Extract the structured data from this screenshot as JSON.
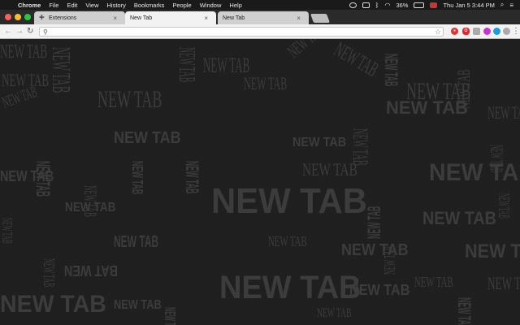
{
  "menubar": {
    "apple_glyph": "",
    "app_name": "Chrome",
    "menus": [
      "File",
      "Edit",
      "View",
      "History",
      "Bookmarks",
      "People",
      "Window",
      "Help"
    ],
    "battery": "36%",
    "clock": "Thu Jan 5  3:44 PM"
  },
  "tabs": [
    {
      "title": "Extensions",
      "icon": "puzzle-icon",
      "active": false
    },
    {
      "title": "New Tab",
      "active": true
    },
    {
      "title": "New Tab",
      "active": false
    }
  ],
  "toolbar": {
    "back_glyph": "←",
    "forward_glyph": "→",
    "reload_glyph": "↻",
    "address_value": "",
    "star_glyph": "☆"
  },
  "content": {
    "art_text": "NEW TAB",
    "art_text_alt": "BAT WEN"
  },
  "colors": {
    "menubar_bg": "#1a1a1a",
    "tab_active": "#f2f2f2",
    "tab_inactive": "#cfcfcf",
    "page_bg": "#1e1e1e",
    "art_text": "#3c3c3c"
  }
}
